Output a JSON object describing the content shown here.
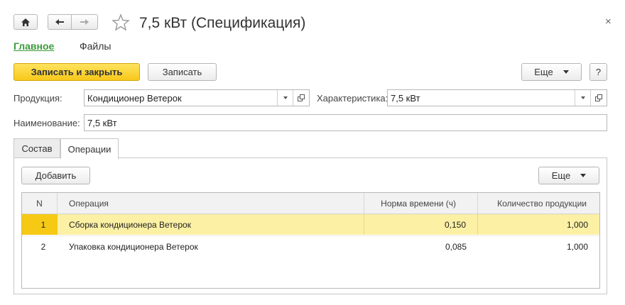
{
  "window": {
    "title": "7,5 кВт (Спецификация)",
    "close": "×"
  },
  "top_tabs": [
    {
      "label": "Главное",
      "active": true
    },
    {
      "label": "Файлы",
      "active": false
    }
  ],
  "toolbar": {
    "save_close_label": "Записать и закрыть",
    "save_label": "Записать",
    "more_label": "Еще",
    "help_label": "?"
  },
  "form": {
    "product_label": "Продукция:",
    "product_value": "Кондиционер Ветерок",
    "characteristic_label": "Характеристика:",
    "characteristic_value": "7,5 кВт",
    "name_label": "Наименование:",
    "name_value": "7,5 кВт"
  },
  "tabs": [
    {
      "label": "Состав",
      "active": false
    },
    {
      "label": "Операции",
      "active": true
    }
  ],
  "operations_panel": {
    "add_label": "Добавить",
    "more_label": "Еще",
    "columns": [
      "N",
      "Операция",
      "Норма времени (ч)",
      "Количество продукции"
    ],
    "rows": [
      {
        "n": "1",
        "operation": "Сборка кондиционера Ветерок",
        "time_norm": "0,150",
        "quantity": "1,000",
        "selected": true
      },
      {
        "n": "2",
        "operation": "Упаковка кондиционера Ветерок",
        "time_norm": "0,085",
        "quantity": "1,000",
        "selected": false
      }
    ]
  },
  "colors": {
    "accent_green": "#3a9a3a",
    "primary_button": "#f7c81a",
    "selected_row": "#fbf0a4"
  }
}
